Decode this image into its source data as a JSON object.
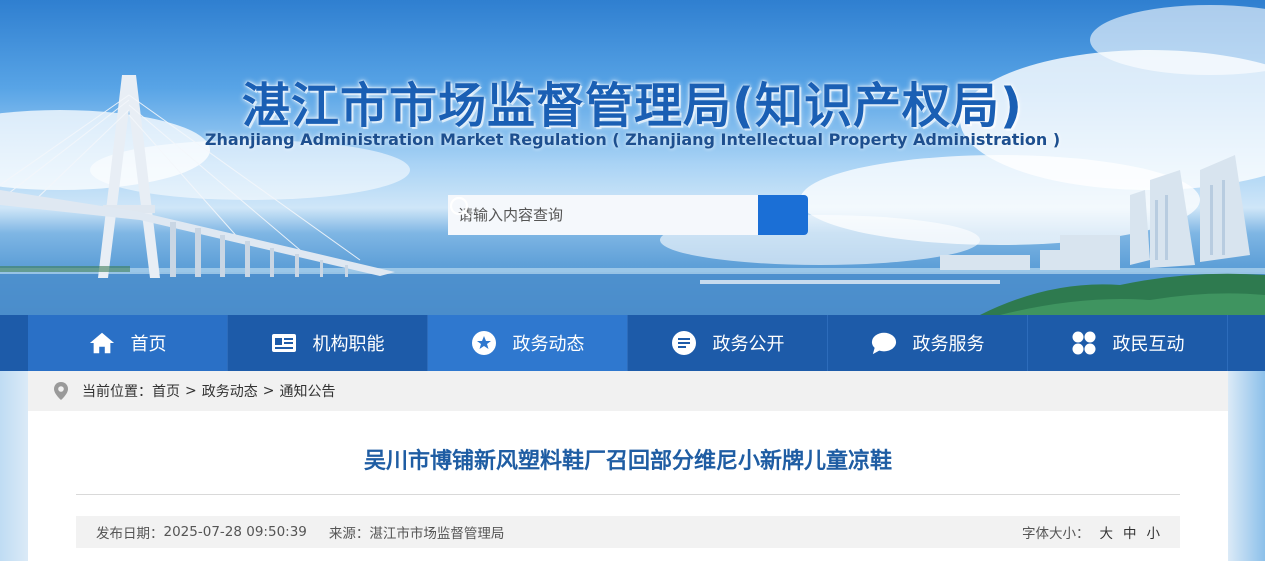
{
  "header": {
    "title": "湛江市市场监督管理局(知识产权局)",
    "subtitle": "Zhanjiang Administration Market Regulation ( Zhanjiang Intellectual Property Administration )"
  },
  "search": {
    "placeholder": "请输入内容查询",
    "icon": "search-icon"
  },
  "nav": {
    "items": [
      {
        "label": "首页",
        "icon": "home-icon"
      },
      {
        "label": "机构职能",
        "icon": "id-card-icon"
      },
      {
        "label": "政务动态",
        "icon": "star-icon"
      },
      {
        "label": "政务公开",
        "icon": "document-icon"
      },
      {
        "label": "政务服务",
        "icon": "chat-bubble-icon"
      },
      {
        "label": "政民互动",
        "icon": "grid-icon"
      }
    ],
    "active_index": 2
  },
  "breadcrumb": {
    "prefix": "当前位置：",
    "items": [
      "首页",
      "政务动态",
      "通知公告"
    ],
    "separator": ">"
  },
  "article": {
    "title": "吴川市博铺新风塑料鞋厂召回部分维尼小新牌儿童凉鞋",
    "publish_label": "发布日期：",
    "publish_date": "2025-07-28 09:50:39",
    "source_label": "来源：",
    "source": "湛江市市场监督管理局",
    "font_size_label": "字体大小：",
    "font_sizes": [
      "大",
      "中",
      "小"
    ]
  },
  "colors": {
    "nav_bg": "#1d5ba9",
    "nav_active": "#2f78cf",
    "title_blue": "#1f5da3",
    "search_button": "#1b6fd6"
  }
}
